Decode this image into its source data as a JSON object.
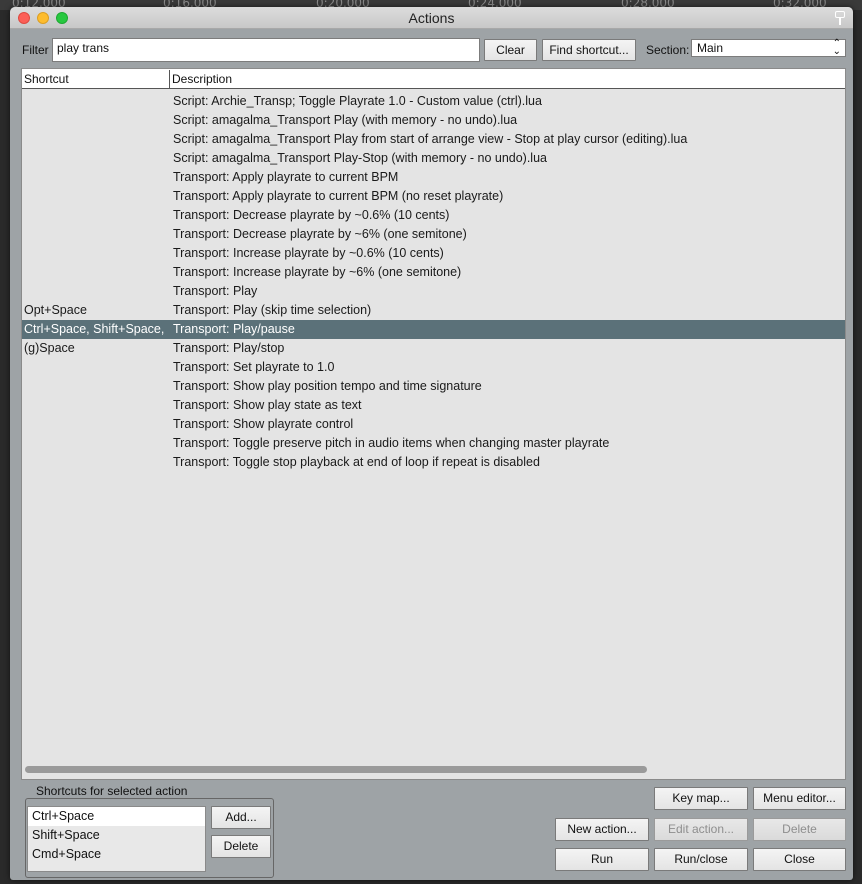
{
  "background": {
    "ruler_labels": [
      "0:12.000",
      "0:16.000",
      "0:20.000",
      "0:24.000",
      "0:28.000",
      "0:32.000"
    ]
  },
  "window": {
    "title": "Actions"
  },
  "filter": {
    "label": "Filter",
    "value": "play trans",
    "clear_label": "Clear",
    "find_shortcut_label": "Find shortcut...",
    "section_label": "Section:",
    "section_value": "Main"
  },
  "list": {
    "col_shortcut": "Shortcut",
    "col_description": "Description",
    "rows": [
      {
        "shortcut": "",
        "description": "Script: Archie_Transp; Toggle Playrate 1.0 - Custom value (ctrl).lua",
        "selected": false
      },
      {
        "shortcut": "",
        "description": "Script: amagalma_Transport Play (with memory - no undo).lua",
        "selected": false
      },
      {
        "shortcut": "",
        "description": "Script: amagalma_Transport Play from start of arrange view - Stop at play cursor (editing).lua",
        "selected": false
      },
      {
        "shortcut": "",
        "description": "Script: amagalma_Transport Play-Stop (with memory - no undo).lua",
        "selected": false
      },
      {
        "shortcut": "",
        "description": "Transport: Apply playrate to current BPM",
        "selected": false
      },
      {
        "shortcut": "",
        "description": "Transport: Apply playrate to current BPM (no reset playrate)",
        "selected": false
      },
      {
        "shortcut": "",
        "description": "Transport: Decrease playrate by ~0.6% (10 cents)",
        "selected": false
      },
      {
        "shortcut": "",
        "description": "Transport: Decrease playrate by ~6% (one semitone)",
        "selected": false
      },
      {
        "shortcut": "",
        "description": "Transport: Increase playrate by ~0.6% (10 cents)",
        "selected": false
      },
      {
        "shortcut": "",
        "description": "Transport: Increase playrate by ~6% (one semitone)",
        "selected": false
      },
      {
        "shortcut": "",
        "description": "Transport: Play",
        "selected": false
      },
      {
        "shortcut": "Opt+Space",
        "description": "Transport: Play (skip time selection)",
        "selected": false
      },
      {
        "shortcut": "Ctrl+Space, Shift+Space,",
        "description": "Transport: Play/pause",
        "selected": true
      },
      {
        "shortcut": "(g)Space",
        "description": "Transport: Play/stop",
        "selected": false
      },
      {
        "shortcut": "",
        "description": "Transport: Set playrate to 1.0",
        "selected": false
      },
      {
        "shortcut": "",
        "description": "Transport: Show play position tempo and time signature",
        "selected": false
      },
      {
        "shortcut": "",
        "description": "Transport: Show play state as text",
        "selected": false
      },
      {
        "shortcut": "",
        "description": "Transport: Show playrate control",
        "selected": false
      },
      {
        "shortcut": "",
        "description": "Transport: Toggle preserve pitch in audio items when changing master playrate",
        "selected": false
      },
      {
        "shortcut": "",
        "description": "Transport: Toggle stop playback at end of loop if repeat is disabled",
        "selected": false
      }
    ]
  },
  "shortcuts_panel": {
    "title": "Shortcuts for selected action",
    "items": [
      "Ctrl+Space",
      "Shift+Space",
      "Cmd+Space"
    ],
    "add_label": "Add...",
    "delete_label": "Delete"
  },
  "buttons": {
    "key_map": "Key map...",
    "menu_editor": "Menu editor...",
    "new_action": "New action...",
    "edit_action": "Edit action...",
    "delete": "Delete",
    "run": "Run",
    "run_close": "Run/close",
    "close": "Close"
  },
  "colors": {
    "selection": "#5b7179",
    "window_bg": "#9ea3a6",
    "list_bg": "#e4e4e4"
  }
}
